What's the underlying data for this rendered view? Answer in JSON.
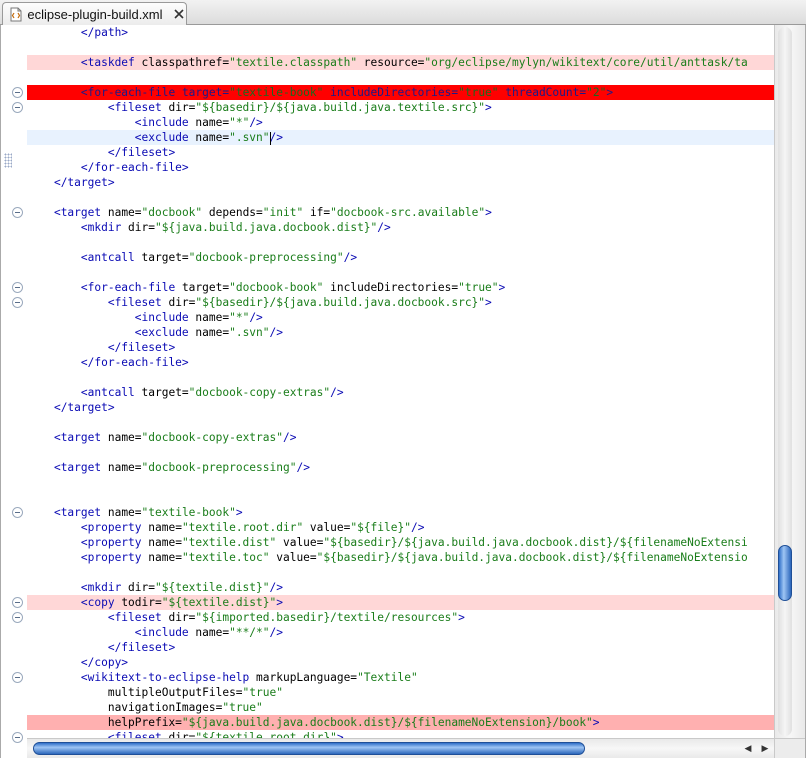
{
  "tab": {
    "title": "eclipse-plugin-build.xml",
    "file_icon": "xml-file-icon",
    "close_icon": "close-icon"
  },
  "colors": {
    "highlight_light": "#ffd7d7",
    "highlight_red": "#ff0000",
    "highlight_pink": "#ffb0b0",
    "tag": "#0a0ab4",
    "value": "#1a7d1a",
    "scroll_thumb": "#3b78d0"
  },
  "code_lines": [
    {
      "indent": 8,
      "parts": [
        [
          "tag",
          "</path>"
        ]
      ]
    },
    {
      "indent": 0,
      "parts": []
    },
    {
      "indent": 8,
      "hl": "light",
      "parts": [
        [
          "tag",
          "<taskdef "
        ],
        [
          "attr",
          "classpathref="
        ],
        [
          "val",
          "\"textile.classpath\""
        ],
        [
          "attr",
          " resource="
        ],
        [
          "val",
          "\"org/eclipse/mylyn/wikitext/core/util/anttask/ta"
        ]
      ]
    },
    {
      "indent": 0,
      "parts": []
    },
    {
      "indent": 8,
      "hl": "red",
      "fold": true,
      "parts": [
        [
          "tag",
          "<for-each-file "
        ],
        [
          "attr",
          "target="
        ],
        [
          "val",
          "\"textile-book\""
        ],
        [
          "attr",
          " includeDirectories="
        ],
        [
          "val",
          "\"true\""
        ],
        [
          "attr",
          " threadCount="
        ],
        [
          "val",
          "\"2\""
        ],
        [
          "tag",
          ">"
        ]
      ]
    },
    {
      "indent": 12,
      "fold": true,
      "parts": [
        [
          "tag",
          "<fileset "
        ],
        [
          "attr",
          "dir="
        ],
        [
          "val",
          "\"${basedir}/${java.build.java.textile.src}\""
        ],
        [
          "tag",
          ">"
        ]
      ]
    },
    {
      "indent": 16,
      "parts": [
        [
          "tag",
          "<include "
        ],
        [
          "attr",
          "name="
        ],
        [
          "val",
          "\"*\""
        ],
        [
          "tag",
          "/>"
        ]
      ]
    },
    {
      "indent": 16,
      "hl": "current",
      "caret": true,
      "parts": [
        [
          "tag",
          "<exclude "
        ],
        [
          "attr",
          "name="
        ],
        [
          "val",
          "\".svn\""
        ],
        [
          "tag",
          "/>"
        ]
      ]
    },
    {
      "indent": 12,
      "parts": [
        [
          "tag",
          "</fileset>"
        ]
      ]
    },
    {
      "indent": 8,
      "parts": [
        [
          "tag",
          "</for-each-file>"
        ]
      ]
    },
    {
      "indent": 4,
      "parts": [
        [
          "tag",
          "</target>"
        ]
      ]
    },
    {
      "indent": 0,
      "parts": []
    },
    {
      "indent": 4,
      "fold": true,
      "parts": [
        [
          "tag",
          "<target "
        ],
        [
          "attr",
          "name="
        ],
        [
          "val",
          "\"docbook\""
        ],
        [
          "attr",
          " depends="
        ],
        [
          "val",
          "\"init\""
        ],
        [
          "attr",
          " if="
        ],
        [
          "val",
          "\"docbook-src.available\""
        ],
        [
          "tag",
          ">"
        ]
      ]
    },
    {
      "indent": 8,
      "parts": [
        [
          "tag",
          "<mkdir "
        ],
        [
          "attr",
          "dir="
        ],
        [
          "val",
          "\"${java.build.java.docbook.dist}\""
        ],
        [
          "tag",
          "/>"
        ]
      ]
    },
    {
      "indent": 0,
      "parts": []
    },
    {
      "indent": 8,
      "parts": [
        [
          "tag",
          "<antcall "
        ],
        [
          "attr",
          "target="
        ],
        [
          "val",
          "\"docbook-preprocessing\""
        ],
        [
          "tag",
          "/>"
        ]
      ]
    },
    {
      "indent": 0,
      "parts": []
    },
    {
      "indent": 8,
      "fold": true,
      "parts": [
        [
          "tag",
          "<for-each-file "
        ],
        [
          "attr",
          "target="
        ],
        [
          "val",
          "\"docbook-book\""
        ],
        [
          "attr",
          " includeDirectories="
        ],
        [
          "val",
          "\"true\""
        ],
        [
          "tag",
          ">"
        ]
      ]
    },
    {
      "indent": 12,
      "fold": true,
      "parts": [
        [
          "tag",
          "<fileset "
        ],
        [
          "attr",
          "dir="
        ],
        [
          "val",
          "\"${basedir}/${java.build.java.docbook.src}\""
        ],
        [
          "tag",
          ">"
        ]
      ]
    },
    {
      "indent": 16,
      "parts": [
        [
          "tag",
          "<include "
        ],
        [
          "attr",
          "name="
        ],
        [
          "val",
          "\"*\""
        ],
        [
          "tag",
          "/>"
        ]
      ]
    },
    {
      "indent": 16,
      "parts": [
        [
          "tag",
          "<exclude "
        ],
        [
          "attr",
          "name="
        ],
        [
          "val",
          "\".svn\""
        ],
        [
          "tag",
          "/>"
        ]
      ]
    },
    {
      "indent": 12,
      "parts": [
        [
          "tag",
          "</fileset>"
        ]
      ]
    },
    {
      "indent": 8,
      "parts": [
        [
          "tag",
          "</for-each-file>"
        ]
      ]
    },
    {
      "indent": 0,
      "parts": []
    },
    {
      "indent": 8,
      "parts": [
        [
          "tag",
          "<antcall "
        ],
        [
          "attr",
          "target="
        ],
        [
          "val",
          "\"docbook-copy-extras\""
        ],
        [
          "tag",
          "/>"
        ]
      ]
    },
    {
      "indent": 4,
      "parts": [
        [
          "tag",
          "</target>"
        ]
      ]
    },
    {
      "indent": 0,
      "parts": []
    },
    {
      "indent": 4,
      "parts": [
        [
          "tag",
          "<target "
        ],
        [
          "attr",
          "name="
        ],
        [
          "val",
          "\"docbook-copy-extras\""
        ],
        [
          "tag",
          "/>"
        ]
      ]
    },
    {
      "indent": 0,
      "parts": []
    },
    {
      "indent": 4,
      "parts": [
        [
          "tag",
          "<target "
        ],
        [
          "attr",
          "name="
        ],
        [
          "val",
          "\"docbook-preprocessing\""
        ],
        [
          "tag",
          "/>"
        ]
      ]
    },
    {
      "indent": 0,
      "parts": []
    },
    {
      "indent": 0,
      "parts": []
    },
    {
      "indent": 4,
      "fold": true,
      "parts": [
        [
          "tag",
          "<target "
        ],
        [
          "attr",
          "name="
        ],
        [
          "val",
          "\"textile-book\""
        ],
        [
          "tag",
          ">"
        ]
      ]
    },
    {
      "indent": 8,
      "parts": [
        [
          "tag",
          "<property "
        ],
        [
          "attr",
          "name="
        ],
        [
          "val",
          "\"textile.root.dir\""
        ],
        [
          "attr",
          " value="
        ],
        [
          "val",
          "\"${file}\""
        ],
        [
          "tag",
          "/>"
        ]
      ]
    },
    {
      "indent": 8,
      "parts": [
        [
          "tag",
          "<property "
        ],
        [
          "attr",
          "name="
        ],
        [
          "val",
          "\"textile.dist\""
        ],
        [
          "attr",
          " value="
        ],
        [
          "val",
          "\"${basedir}/${java.build.java.docbook.dist}/${filenameNoExtensi"
        ]
      ]
    },
    {
      "indent": 8,
      "parts": [
        [
          "tag",
          "<property "
        ],
        [
          "attr",
          "name="
        ],
        [
          "val",
          "\"textile.toc\""
        ],
        [
          "attr",
          " value="
        ],
        [
          "val",
          "\"${basedir}/${java.build.java.docbook.dist}/${filenameNoExtensio"
        ]
      ]
    },
    {
      "indent": 0,
      "parts": []
    },
    {
      "indent": 8,
      "parts": [
        [
          "tag",
          "<mkdir "
        ],
        [
          "attr",
          "dir="
        ],
        [
          "val",
          "\"${textile.dist}\""
        ],
        [
          "tag",
          "/>"
        ]
      ]
    },
    {
      "indent": 8,
      "hl": "light",
      "fold": true,
      "parts": [
        [
          "tag",
          "<copy "
        ],
        [
          "attr",
          "todir="
        ],
        [
          "val",
          "\"${textile.dist}\""
        ],
        [
          "tag",
          ">"
        ]
      ]
    },
    {
      "indent": 12,
      "fold": true,
      "parts": [
        [
          "tag",
          "<fileset "
        ],
        [
          "attr",
          "dir="
        ],
        [
          "val",
          "\"${imported.basedir}/textile/resources\""
        ],
        [
          "tag",
          ">"
        ]
      ]
    },
    {
      "indent": 16,
      "parts": [
        [
          "tag",
          "<include "
        ],
        [
          "attr",
          "name="
        ],
        [
          "val",
          "\"**/*\""
        ],
        [
          "tag",
          "/>"
        ]
      ]
    },
    {
      "indent": 12,
      "parts": [
        [
          "tag",
          "</fileset>"
        ]
      ]
    },
    {
      "indent": 8,
      "parts": [
        [
          "tag",
          "</copy>"
        ]
      ]
    },
    {
      "indent": 8,
      "fold": true,
      "parts": [
        [
          "tag",
          "<wikitext-to-eclipse-help "
        ],
        [
          "attr",
          "markupLanguage="
        ],
        [
          "val",
          "\"Textile\""
        ]
      ]
    },
    {
      "indent": 12,
      "parts": [
        [
          "attr",
          "multipleOutputFiles="
        ],
        [
          "val",
          "\"true\""
        ]
      ]
    },
    {
      "indent": 12,
      "parts": [
        [
          "attr",
          "navigationImages="
        ],
        [
          "val",
          "\"true\""
        ]
      ]
    },
    {
      "indent": 12,
      "hl": "pink",
      "parts": [
        [
          "attr",
          "helpPrefix="
        ],
        [
          "val",
          "\"${java.build.java.docbook.dist}/${filenameNoExtension}/book\""
        ],
        [
          "tag",
          ">"
        ]
      ]
    },
    {
      "indent": 12,
      "fold": true,
      "parts": [
        [
          "tag",
          "<fileset "
        ],
        [
          "attr",
          "dir="
        ],
        [
          "val",
          "\"${textile.root.dir}\""
        ],
        [
          "tag",
          ">"
        ]
      ]
    }
  ]
}
